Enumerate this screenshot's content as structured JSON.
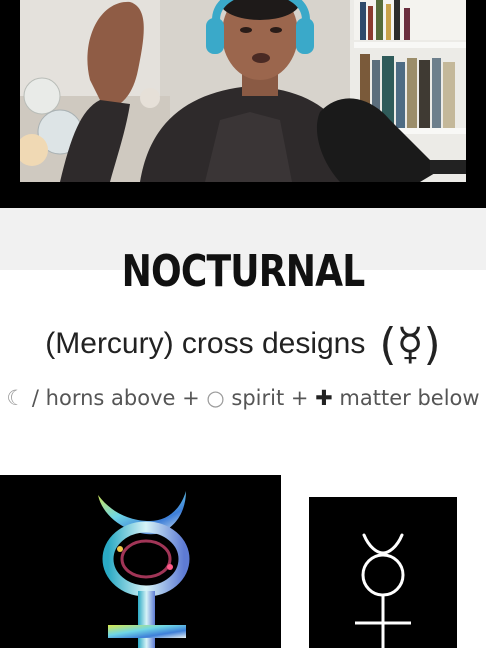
{
  "video": {
    "scene": "webcam"
  },
  "slide": {
    "title": "NOCTURNAL",
    "subtitle": "(Mercury) cross designs",
    "subtitle_symbol": "☿",
    "formula": {
      "moon_glyph": "☾",
      "horns_text": " / horns above + ",
      "circle_glyph": "○",
      "spirit_text": " spirit + ",
      "cross_glyph": "✚",
      "matter_text": " matter below"
    }
  },
  "colors": {
    "background": "#ffffff",
    "band": "#f1f1f1",
    "title": "#111111",
    "formula": "#555555"
  }
}
